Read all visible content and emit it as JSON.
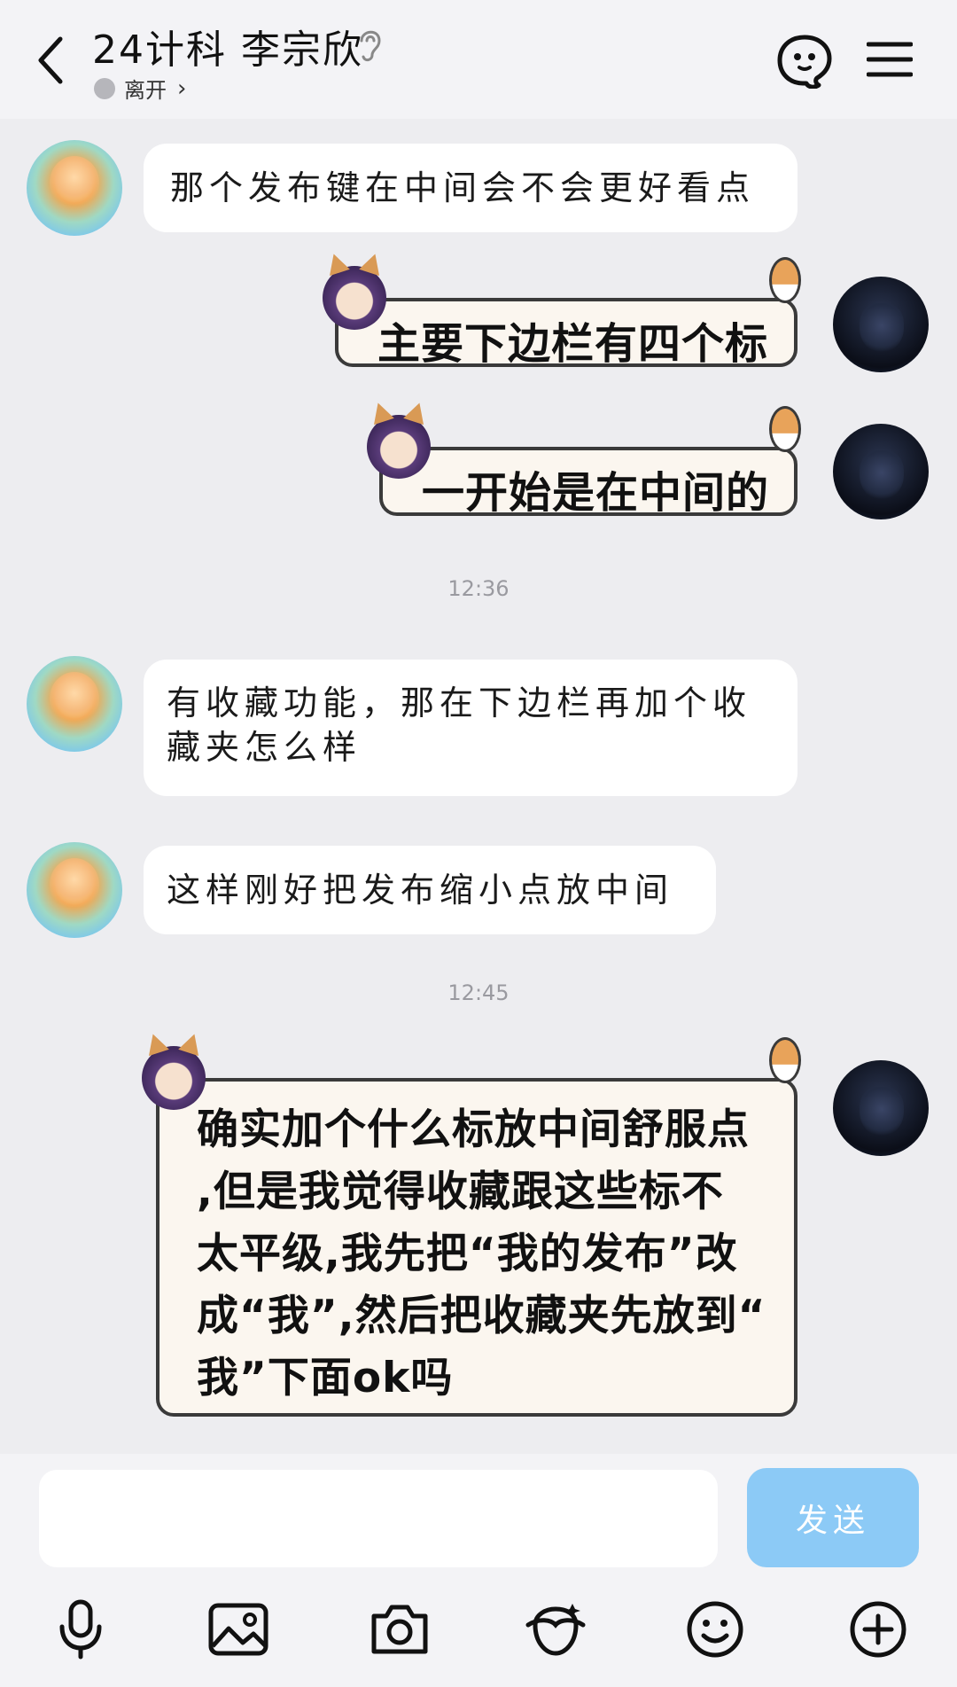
{
  "header": {
    "title": "24计科 李宗欣",
    "status": "离开",
    "status_chevron": "›"
  },
  "messages": [
    {
      "from": "friend",
      "text": "那个发布键在中间会不会更好看点"
    },
    {
      "from": "me",
      "type": "sticker",
      "text": "主要下边栏有四个标"
    },
    {
      "from": "me",
      "type": "sticker",
      "text": "一开始是在中间的"
    },
    {
      "type": "time",
      "text": "12:36"
    },
    {
      "from": "friend",
      "lines": [
        "有收藏功能，那在下边栏再加个收",
        "藏夹怎么样"
      ]
    },
    {
      "from": "friend",
      "text": "这样刚好把发布缩小点放中间"
    },
    {
      "type": "time",
      "text": "12:45"
    },
    {
      "from": "me",
      "type": "sticker",
      "lines": [
        "确实加个什么标放中间舒服点",
        ",但是我觉得收藏跟这些标不",
        "太平级,我先把“我的发布”改",
        "成“我”,然后把收藏夹先放到“",
        "我”下面ok吗"
      ]
    }
  ],
  "input": {
    "placeholder": "",
    "send_label": "发送"
  },
  "toolbar": [
    "microphone-icon",
    "image-icon",
    "camera-icon",
    "face-effect-icon",
    "emoji-icon",
    "plus-icon"
  ],
  "colors": {
    "send": "#8ccaf6",
    "background": "#ededf0",
    "header": "#f3f3f6"
  }
}
